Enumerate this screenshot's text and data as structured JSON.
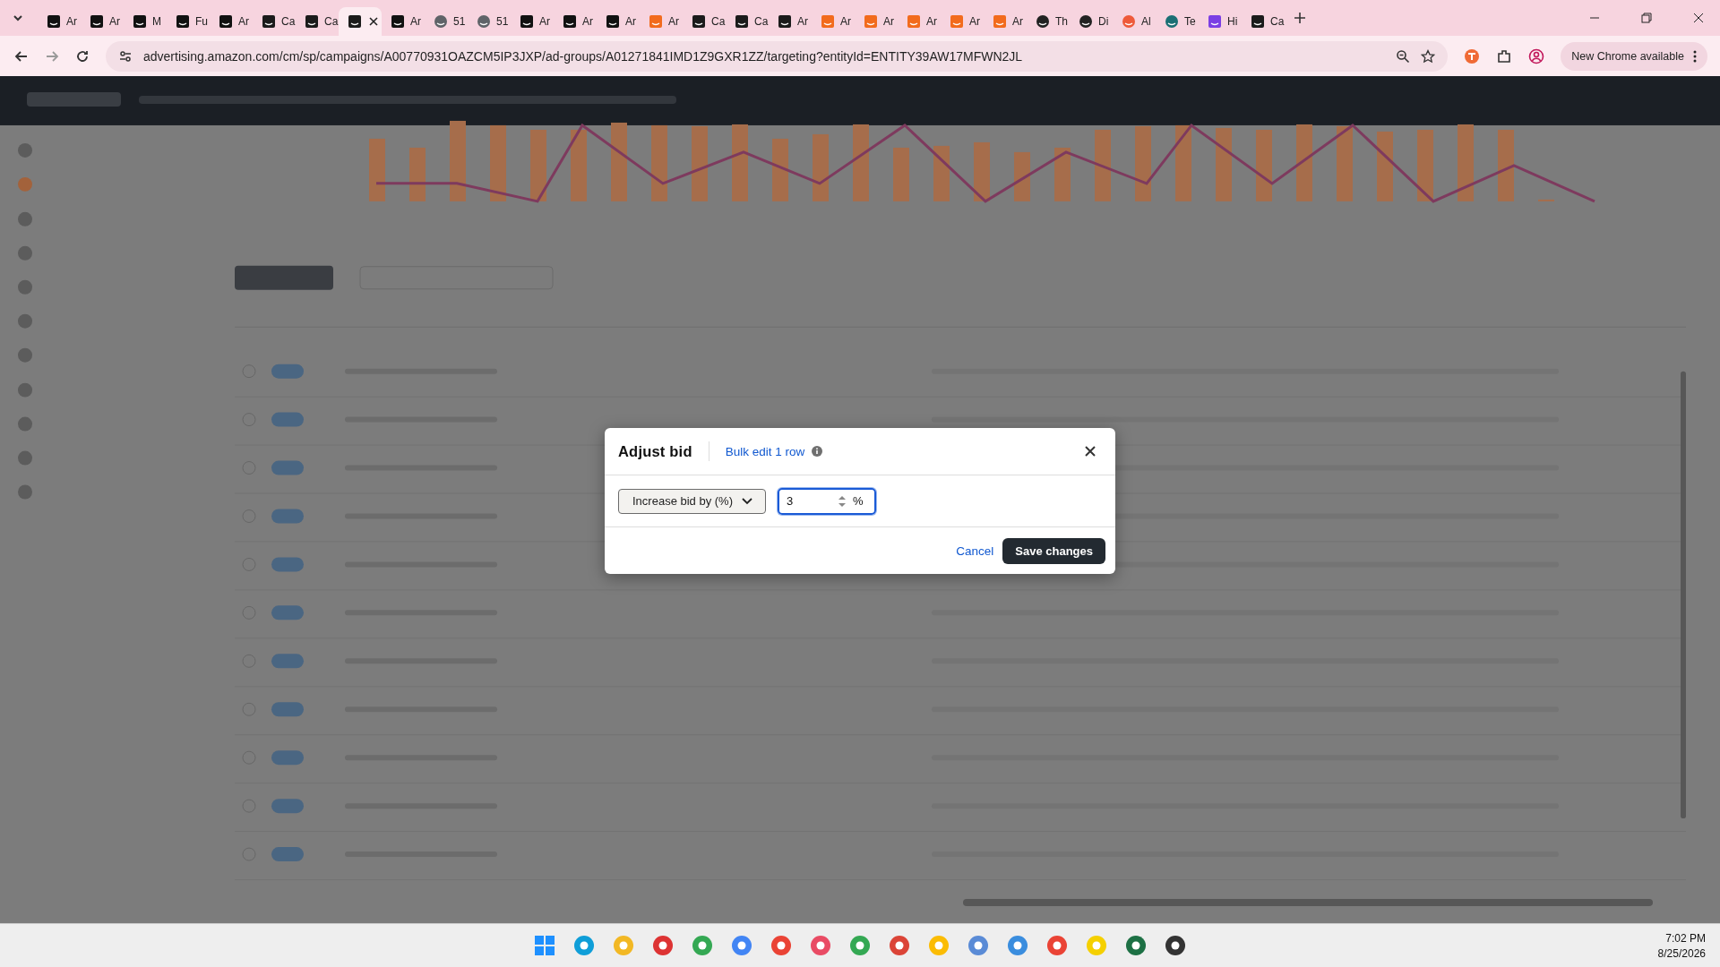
{
  "browser": {
    "tabs": [
      {
        "title": "Ar",
        "kind": "amazon",
        "selected": false
      },
      {
        "title": "Ar",
        "kind": "amazon",
        "selected": false
      },
      {
        "title": "M",
        "kind": "amazon",
        "selected": false
      },
      {
        "title": "Fu",
        "kind": "amazon",
        "selected": false
      },
      {
        "title": "Ar",
        "kind": "amazon",
        "selected": false
      },
      {
        "title": "Ca",
        "kind": "dark",
        "selected": false
      },
      {
        "title": "Ca",
        "kind": "dark",
        "selected": false
      },
      {
        "kind": "dark",
        "selected": true
      },
      {
        "title": "Ar",
        "kind": "amazon",
        "selected": false
      },
      {
        "title": "51",
        "kind": "globe",
        "selected": false
      },
      {
        "title": "51",
        "kind": "globe",
        "selected": false
      },
      {
        "title": "Ar",
        "kind": "amazon",
        "selected": false
      },
      {
        "title": "Ar",
        "kind": "amazon",
        "selected": false
      },
      {
        "title": "Ar",
        "kind": "amazon",
        "selected": false
      },
      {
        "title": "Ar",
        "kind": "orange",
        "selected": false
      },
      {
        "title": "Ca",
        "kind": "dark",
        "selected": false
      },
      {
        "title": "Ca",
        "kind": "dark",
        "selected": false
      },
      {
        "title": "Ar",
        "kind": "dark",
        "selected": false
      },
      {
        "title": "Ar",
        "kind": "orange",
        "selected": false
      },
      {
        "title": "Ar",
        "kind": "orange",
        "selected": false
      },
      {
        "title": "Ar",
        "kind": "orange",
        "selected": false
      },
      {
        "title": "Ar",
        "kind": "orange",
        "selected": false
      },
      {
        "title": "Ar",
        "kind": "orange",
        "selected": false
      },
      {
        "title": "Th",
        "kind": "ring",
        "selected": false
      },
      {
        "title": "Di",
        "kind": "ring",
        "selected": false
      },
      {
        "title": "Al",
        "kind": "coral",
        "selected": false
      },
      {
        "title": "Te",
        "kind": "teal",
        "selected": false
      },
      {
        "title": "Hi",
        "kind": "purple",
        "selected": false
      },
      {
        "title": "Ca",
        "kind": "dark",
        "selected": false
      }
    ],
    "address": "advertising.amazon.com/cm/sp/campaigns/A00770931OAZCM5IP3JXP/ad-groups/A01271841IMD1Z9GXR1ZZ/targeting?entityId=ENTITY39AW17MFWN2JL",
    "update_button": "New Chrome available"
  },
  "dialog": {
    "title": "Adjust bid",
    "link": "Bulk edit 1 row",
    "action_select": "Increase bid by (%)",
    "bid_input": {
      "value": "3",
      "unit": "%"
    },
    "cancel": "Cancel",
    "save": "Save changes"
  },
  "taskbar": {
    "time": "7:02 PM",
    "date": "8/25/2026"
  }
}
